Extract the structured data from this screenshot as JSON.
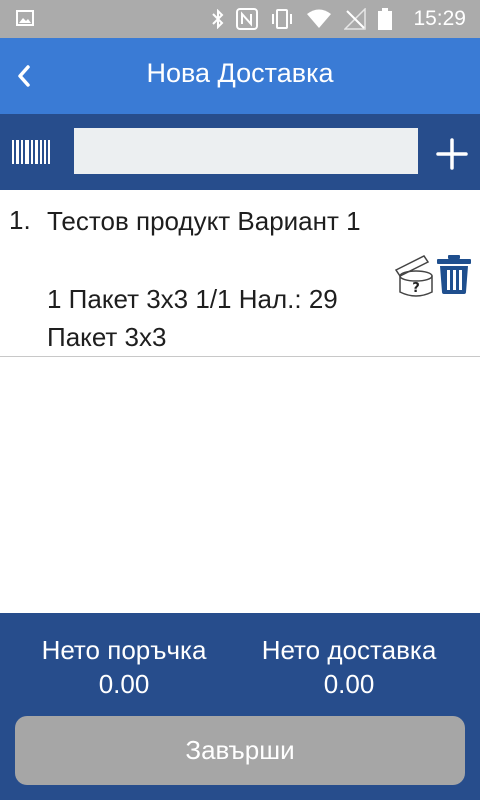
{
  "status_bar": {
    "time": "15:29",
    "icons": [
      "image-icon",
      "bluetooth-icon",
      "nfc-icon",
      "vibrate-icon",
      "wifi-icon",
      "no-signal-icon",
      "battery-icon"
    ]
  },
  "app_bar": {
    "title": "Нова Доставка",
    "back_icon": "chevron-left-icon"
  },
  "search": {
    "value": "",
    "placeholder": "",
    "barcode_icon": "barcode-icon",
    "add_icon": "plus-icon"
  },
  "items": [
    {
      "number": "1.",
      "name": "Тестов продукт Вариант 1",
      "detail": "1 Пакет 3x3 1/1 Нал.: 29 Пакет 3x3"
    }
  ],
  "footer": {
    "order_label": "Нето поръчка",
    "order_value": "0.00",
    "delivery_label": "Нето доставка",
    "delivery_value": "0.00",
    "finish_label": "Завърши"
  },
  "colors": {
    "status_bar": "#ababab",
    "app_bar": "#3a7bd5",
    "dark_blue": "#274d8c",
    "finish_button": "#a6a6a6"
  }
}
